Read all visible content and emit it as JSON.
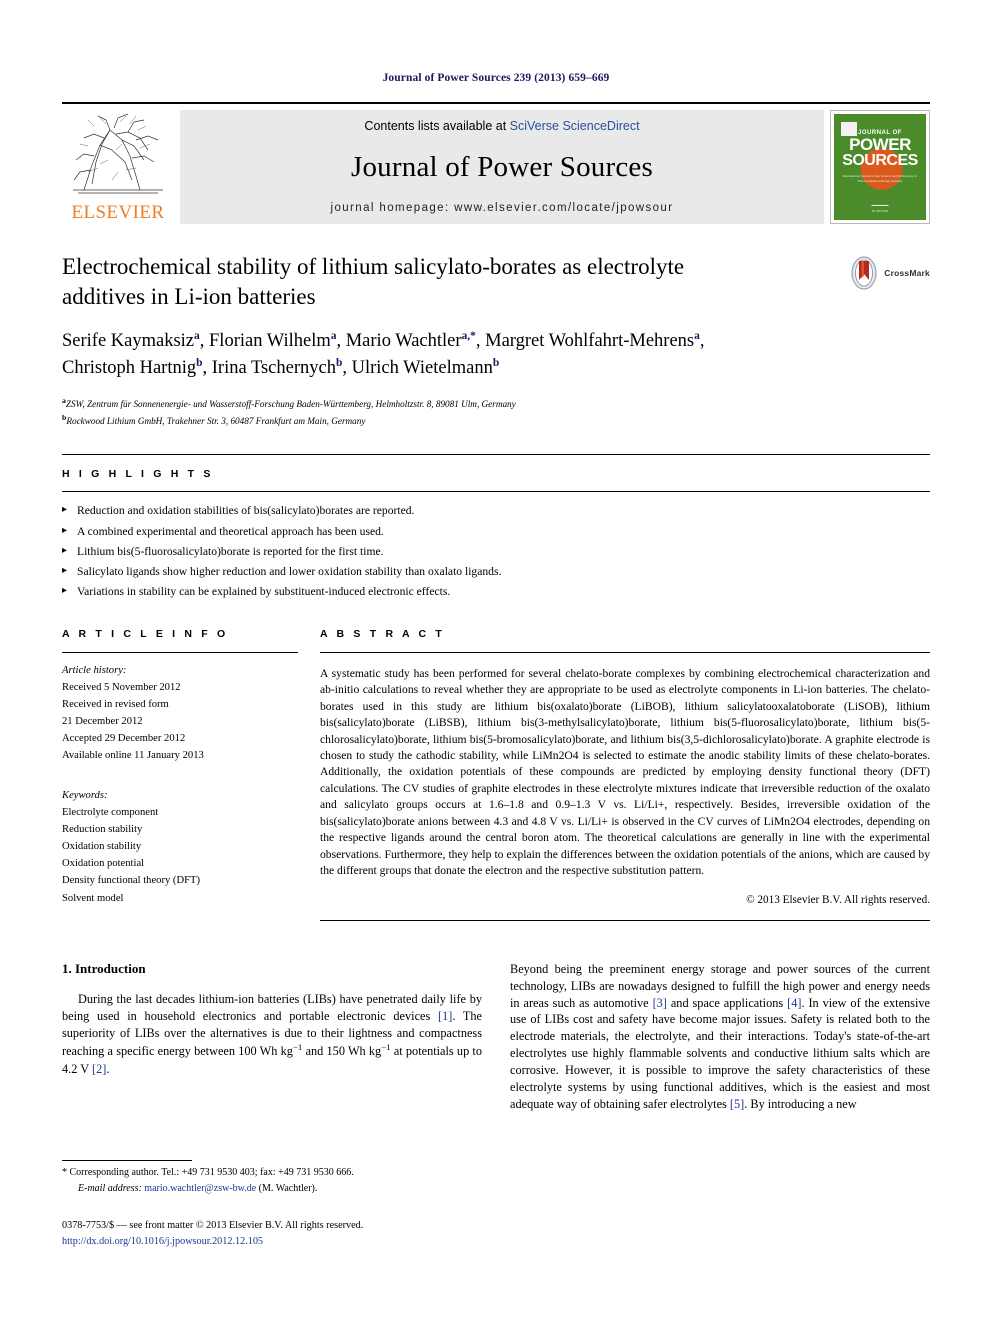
{
  "running_head": "Journal of Power Sources 239 (2013) 659–669",
  "masthead": {
    "contents_prefix": "Contents lists available at ",
    "contents_link": "SciVerse ScienceDirect",
    "journal_title": "Journal of Power Sources",
    "homepage": "journal homepage: www.elsevier.com/locate/jpowsour",
    "publisher_name": "ELSEVIER",
    "cover": {
      "journal_of": "JOURNAL OF",
      "power": "POWER",
      "sources": "SOURCES",
      "tagline": "International journal on the Science and Technology of Electrochemical Energy Systems"
    }
  },
  "article": {
    "title": "Electrochemical stability of lithium salicylato-borates as electrolyte additives in Li-ion batteries",
    "crossmark_label": "CrossMark",
    "authors_line1": "Serife Kaymaksiz a, Florian Wilhelm a, Mario Wachtler a,*, Margret Wohlfahrt-Mehrens a,",
    "authors_line2": "Christoph Hartnig b, Irina Tschernych b, Ulrich Wietelmann b",
    "affiliation_a": "ZSW, Zentrum für Sonnenenergie- und Wasserstoff-Forschung Baden-Württemberg, Helmholtzstr. 8, 89081 Ulm, Germany",
    "affiliation_b": "Rockwood Lithium GmbH, Trakehner Str. 3, 60487 Frankfurt am Main, Germany"
  },
  "highlights": {
    "heading": "H I G H L I G H T S",
    "items": [
      "Reduction and oxidation stabilities of bis(salicylato)borates are reported.",
      "A combined experimental and theoretical approach has been used.",
      "Lithium bis(5-fluorosalicylato)borate is reported for the first time.",
      "Salicylato ligands show higher reduction and lower oxidation stability than oxalato ligands.",
      "Variations in stability can be explained by substituent-induced electronic effects."
    ]
  },
  "article_info": {
    "heading": "A R T I C L E    I N F O",
    "history_label": "Article history:",
    "history": [
      "Received 5 November 2012",
      "Received in revised form",
      "21 December 2012",
      "Accepted 29 December 2012",
      "Available online 11 January 2013"
    ],
    "keywords_label": "Keywords:",
    "keywords": [
      "Electrolyte component",
      "Reduction stability",
      "Oxidation stability",
      "Oxidation potential",
      "Density functional theory (DFT)",
      "Solvent model"
    ]
  },
  "abstract": {
    "heading": "A B S T R A C T",
    "text": "A systematic study has been performed for several chelato-borate complexes by combining electrochemical characterization and ab-initio calculations to reveal whether they are appropriate to be used as electrolyte components in Li-ion batteries. The chelato-borates used in this study are lithium bis(oxalato)borate (LiBOB), lithium salicylatooxalatoborate (LiSOB), lithium bis(salicylato)borate (LiBSB), lithium bis(3-methylsalicylato)borate, lithium bis(5-fluorosalicylato)borate, lithium bis(5-chlorosalicylato)borate, lithium bis(5-bromosalicylato)borate, and lithium bis(3,5-dichlorosalicylato)borate. A graphite electrode is chosen to study the cathodic stability, while LiMn2O4 is selected to estimate the anodic stability limits of these chelato-borates. Additionally, the oxidation potentials of these compounds are predicted by employing density functional theory (DFT) calculations. The CV studies of graphite electrodes in these electrolyte mixtures indicate that irreversible reduction of the oxalato and salicylato groups occurs at 1.6–1.8 and 0.9–1.3 V vs. Li/Li+, respectively. Besides, irreversible oxidation of the bis(salicylato)borate anions between 4.3 and 4.8 V vs. Li/Li+ is observed in the CV curves of LiMn2O4 electrodes, depending on the respective ligands around the central boron atom. The theoretical calculations are generally in line with the experimental observations. Furthermore, they help to explain the differences between the oxidation potentials of the anions, which are caused by the different groups that donate the electron and the respective substitution pattern.",
    "copyright": "© 2013 Elsevier B.V. All rights reserved."
  },
  "body": {
    "section_number_title": "1.  Introduction",
    "left_paragraph": "During the last decades lithium-ion batteries (LIBs) have penetrated daily life by being used in household electronics and portable electronic devices [1]. The superiority of LIBs over the alternatives is due to their lightness and compactness reaching a specific energy between 100 Wh kg−1 and 150 Wh kg−1 at potentials up to 4.2 V [2].",
    "right_paragraph": "Beyond being the preeminent energy storage and power sources of the current technology, LIBs are nowadays designed to fulfill the high power and energy needs in areas such as automotive [3] and space applications [4]. In view of the extensive use of LIBs cost and safety have become major issues. Safety is related both to the electrode materials, the electrolyte, and their interactions. Today's state-of-the-art electrolytes use highly flammable solvents and conductive lithium salts which are corrosive. However, it is possible to improve the safety characteristics of these electrolyte systems by using functional additives, which is the easiest and most adequate way of obtaining safer electrolytes [5]. By introducing a new"
  },
  "footnote": {
    "line1": "* Corresponding author. Tel.: +49 731 9530 403; fax: +49 731 9530 666.",
    "email_label": "E-mail address:",
    "email": "mario.wachtler@zsw-bw.de",
    "email_suffix": "(M. Wachtler)."
  },
  "footer": {
    "line1": "0378-7753/$ — see front matter © 2013 Elsevier B.V. All rights reserved.",
    "doi": "http://dx.doi.org/10.1016/j.jpowsour.2012.12.105"
  },
  "colors": {
    "link_blue": "#2a4fa2",
    "ref_blue": "#1a3a8f",
    "elsevier_orange": "#ef7d22",
    "cover_green": "#4b8b29",
    "header_navy": "#1a1a5e"
  }
}
